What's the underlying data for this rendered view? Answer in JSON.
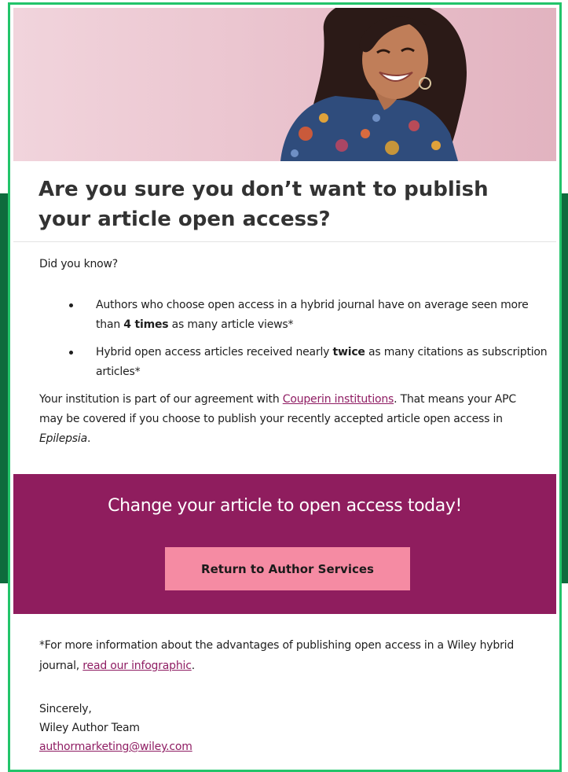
{
  "colors": {
    "frame": "#22c46a",
    "side_panel": "#0e6b3d",
    "band": "#8f1d5e",
    "button": "#f58ba3",
    "link": "#8f1d63"
  },
  "headline": "Are you sure you don’t want to publish your article open access?",
  "did_you_know": "Did you know?",
  "bullets": {
    "b1": {
      "pre": "Authors who choose open access in a hybrid journal have on average seen more than ",
      "bold": "4 times",
      "post": " as many article views*"
    },
    "b2": {
      "pre": "Hybrid open access articles received nearly ",
      "bold": "twice",
      "post": " as many citations as subscription articles*"
    }
  },
  "institution": {
    "pre": "Your institution is part of our agreement with ",
    "link": "Couperin institutions",
    "mid": ". That means your APC may be covered if you choose to publish your recently accepted article open access in ",
    "journal": "Epilepsia",
    "post": "."
  },
  "cta": {
    "title": "Change your article to open access today!",
    "button_label": "Return to Author Services"
  },
  "footnote": {
    "pre": "*For more information about the advantages of publishing open access in a Wiley hybrid journal, ",
    "link": "read our infographic",
    "post": "."
  },
  "signature": {
    "closing": "Sincerely,",
    "team": "Wiley Author Team",
    "email": "authormarketing@wiley.com"
  }
}
